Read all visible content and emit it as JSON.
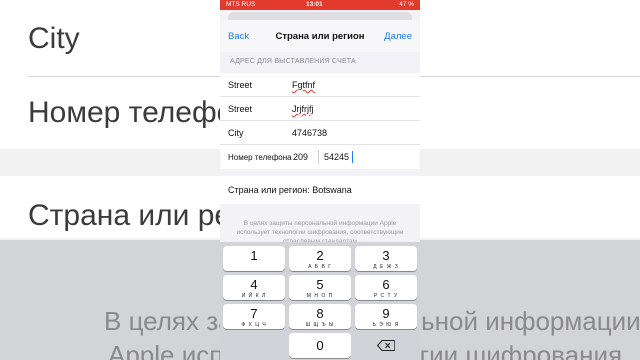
{
  "background": {
    "labels": [
      "City",
      "Номер телефона",
      "Страна или регион"
    ],
    "notes": [
      "В целях защиты персональной информации",
      "Apple использует технологии шифрования,"
    ]
  },
  "status_bar": {
    "carrier": "MTS RUS",
    "time": "13:01",
    "battery": "47 %"
  },
  "nav": {
    "back_label": "Back",
    "title": "Страна или регион",
    "next_label": "Далее"
  },
  "section_header": "АДРЕС ДЛЯ ВЫСТАВЛЕНИЯ СЧЕТА",
  "form": {
    "rows": [
      {
        "label": "Street",
        "value": "Fgtfnf"
      },
      {
        "label": "Street",
        "value": "Jrjfrjfj"
      },
      {
        "label": "City",
        "value": "4746738"
      }
    ],
    "phone": {
      "label": "Номер телефона",
      "code": "209",
      "number": "54245"
    }
  },
  "country_line": "Страна или регион: Botswana",
  "privacy_text": "В целях защиты персональной информации Apple использует технологии шифрования, соответствующие отраслевым стандартам",
  "keyboard": {
    "keys": [
      {
        "digit": "1",
        "letters": ""
      },
      {
        "digit": "2",
        "letters": "А Б В Г"
      },
      {
        "digit": "3",
        "letters": "Д Е Ж З"
      },
      {
        "digit": "4",
        "letters": "И Й К Л"
      },
      {
        "digit": "5",
        "letters": "М Н О П"
      },
      {
        "digit": "6",
        "letters": "Р С Т У"
      },
      {
        "digit": "7",
        "letters": "Ф Х Ц Ч"
      },
      {
        "digit": "8",
        "letters": "Ш Щ Ъ Ы"
      },
      {
        "digit": "9",
        "letters": "Ь Э Ю Я"
      },
      {
        "digit": "0",
        "letters": ""
      }
    ],
    "delete_icon": "delete-backspace-icon"
  },
  "colors": {
    "accent": "#1c7cf4",
    "status_bar": "#e23b2e"
  }
}
